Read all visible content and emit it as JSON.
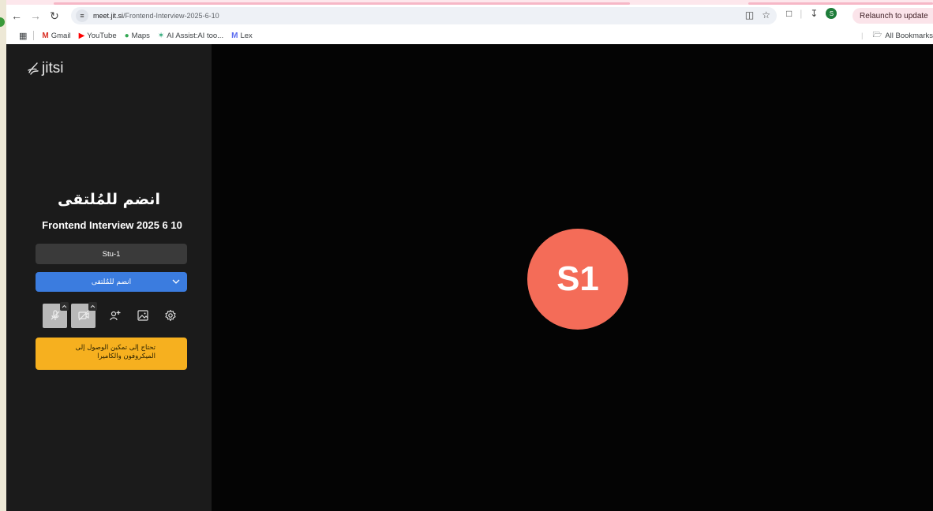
{
  "browser": {
    "url_host": "meet.jit.si",
    "url_path": "/Frontend-Interview-2025-6-10",
    "relaunch_label": "Relaunch to update",
    "profile_initial": "S"
  },
  "bookmarks": {
    "items": [
      {
        "label": "Gmail",
        "icon": "gmail-icon"
      },
      {
        "label": "YouTube",
        "icon": "youtube-icon"
      },
      {
        "label": "Maps",
        "icon": "maps-icon"
      },
      {
        "label": "AI Assist:AI too...",
        "icon": "ai-assist-icon"
      },
      {
        "label": "Lex",
        "icon": "lex-icon"
      }
    ],
    "all_label": "All Bookmarks"
  },
  "jitsi": {
    "logo_text": "jitsi",
    "join_heading": "انضم للمُلتقى",
    "meeting_name": "Frontend Interview 2025 6 10",
    "display_name": "Stu-1",
    "join_button_label": "انضم للمُلتقى",
    "permission_warning": "تحتاج إلى تمكين الوصول إلى الميكروفون والكاميرا",
    "avatar_initials": "S1",
    "avatar_color": "#f46c58",
    "join_button_color": "#3b7cdf",
    "warning_color": "#f6b01f"
  }
}
